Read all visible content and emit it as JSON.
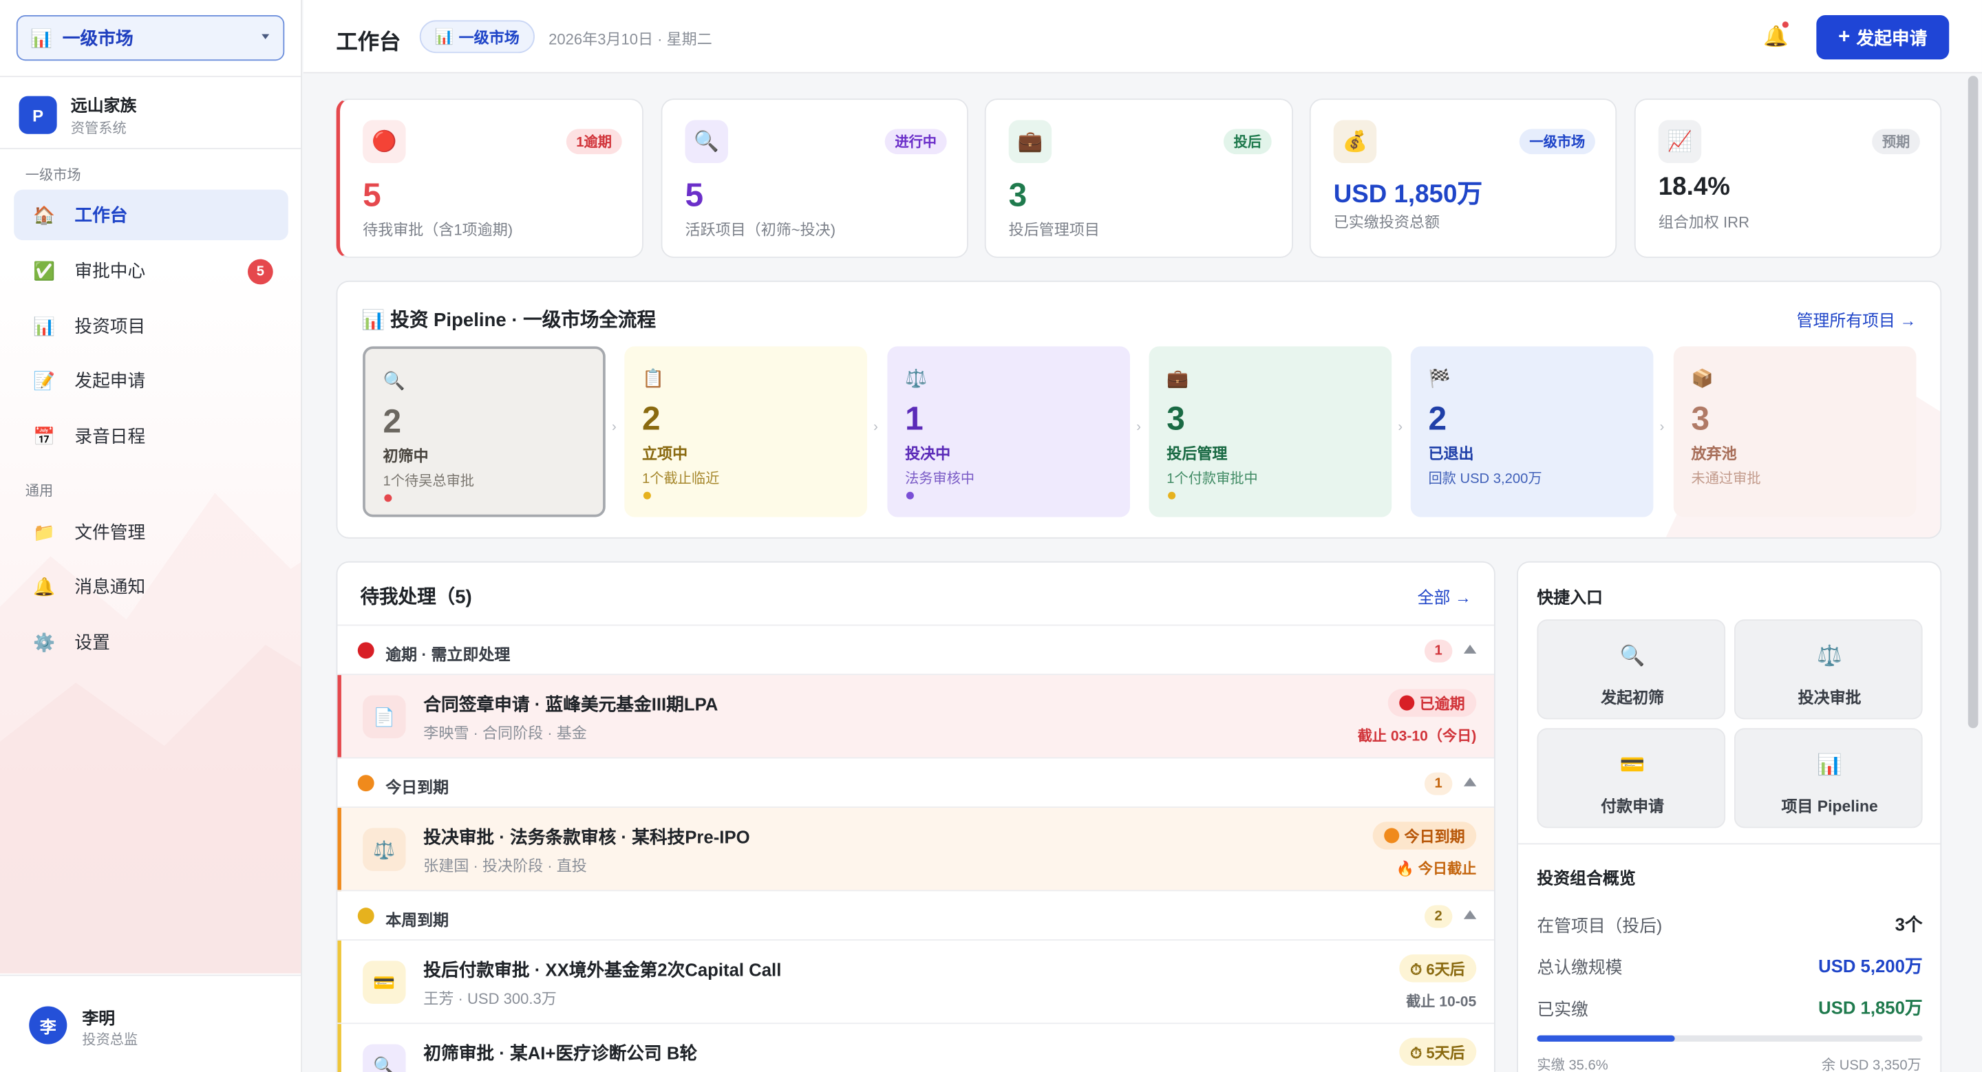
{
  "sidebar": {
    "market_select": "一级市场",
    "org_logo": "P",
    "org_name": "远山家族",
    "org_sub": "资管系统",
    "section1": "一级市场",
    "items1": [
      {
        "label": "工作台",
        "icon": "home-icon",
        "glyph": "🏠",
        "active": true
      },
      {
        "label": "审批中心",
        "icon": "check-icon",
        "glyph": "✅",
        "badge": "5"
      },
      {
        "label": "投资项目",
        "icon": "chart-icon",
        "glyph": "📊"
      },
      {
        "label": "发起申请",
        "icon": "memo-icon",
        "glyph": "📝"
      },
      {
        "label": "录音日程",
        "icon": "calendar-icon",
        "glyph": "📅"
      }
    ],
    "section2": "通用",
    "items2": [
      {
        "label": "文件管理",
        "icon": "folder-icon",
        "glyph": "📁"
      },
      {
        "label": "消息通知",
        "icon": "bell-icon",
        "glyph": "🔔"
      },
      {
        "label": "设置",
        "icon": "gear-icon",
        "glyph": "⚙️"
      }
    ],
    "user_avatar": "李",
    "user_name": "李明",
    "user_role": "投资总监"
  },
  "header": {
    "title": "工作台",
    "market_pill": "一级市场",
    "date": "2026年3月10日 · 星期二",
    "new_button": "发起申请"
  },
  "stats": [
    {
      "icon": "red-circle-icon",
      "glyph": "🔴",
      "tag": "1逾期",
      "value": "5",
      "label": "待我审批（含1项逾期)",
      "color": "#e5484d",
      "icon_bg": "#fdecec",
      "tag_bg": "#fde1e2",
      "tag_color": "#d1343a"
    },
    {
      "icon": "magnifier-icon",
      "glyph": "🔍",
      "tag": "进行中",
      "value": "5",
      "label": "活跃项目（初筛~投决)",
      "color": "#6b2fc9",
      "icon_bg": "#efeafd",
      "tag_bg": "#efe7fd",
      "tag_color": "#6b2fc9"
    },
    {
      "icon": "briefcase-icon",
      "glyph": "💼",
      "tag": "投后",
      "value": "3",
      "label": "投后管理项目",
      "color": "#1f7a4d",
      "icon_bg": "#e8f5ee",
      "tag_bg": "#e2f4ea",
      "tag_color": "#1f7a4d"
    },
    {
      "icon": "moneybag-icon",
      "glyph": "💰",
      "tag": "一级市场",
      "value": "USD 1,850万",
      "label": "已实缴投资总额",
      "color": "#1f45c8",
      "icon_bg": "#f7f0e3",
      "tag_bg": "#e6edfc",
      "tag_color": "#1f45c8"
    },
    {
      "icon": "trend-icon",
      "glyph": "📈",
      "tag": "预期",
      "value": "18.4%",
      "label": "组合加权 IRR",
      "color": "#1f2328",
      "icon_bg": "#f0f1f3",
      "tag_bg": "#eeeff2",
      "tag_color": "#8a8f98"
    }
  ],
  "pipeline": {
    "title": "投资 Pipeline · 一级市场全流程",
    "link": "管理所有项目 →",
    "stages": [
      {
        "icon": "magnifier-icon",
        "glyph": "🔍",
        "count": "2",
        "name": "初筛中",
        "sub": "1个待吴总审批",
        "bg": "#f1efec",
        "num_color": "#6b6760",
        "name_color": "#4a4640",
        "sub_color": "#7a766f",
        "dot": "#e5484d"
      },
      {
        "icon": "clipboard-icon",
        "glyph": "📋",
        "count": "2",
        "name": "立项中",
        "sub": "1个截止临近",
        "bg": "#fefbe8",
        "num_color": "#8a6a10",
        "name_color": "#8a6a10",
        "sub_color": "#a5862a",
        "dot": "#e6b21e"
      },
      {
        "icon": "scales-icon",
        "glyph": "⚖️",
        "count": "1",
        "name": "投决中",
        "sub": "法务审核中",
        "bg": "#efeafd",
        "num_color": "#5b2bb8",
        "name_color": "#5b2bb8",
        "sub_color": "#7a5bc6",
        "dot": "#7a4fd6"
      },
      {
        "icon": "briefcase-icon",
        "glyph": "💼",
        "count": "3",
        "name": "投后管理",
        "sub": "1个付款审批中",
        "bg": "#e8f5ee",
        "num_color": "#1a6a44",
        "name_color": "#1a6a44",
        "sub_color": "#3f8a63",
        "dot": "#e6b21e"
      },
      {
        "icon": "checkered-flag-icon",
        "glyph": "🏁",
        "count": "2",
        "name": "已退出",
        "sub": "回款 USD 3,200万",
        "bg": "#e9effc",
        "num_color": "#1f3fa8",
        "name_color": "#1f3fa8",
        "sub_color": "#3f5fb8",
        "dot": ""
      },
      {
        "icon": "package-icon",
        "glyph": "📦",
        "count": "3",
        "name": "放弃池",
        "sub": "未通过审批",
        "bg": "#fbf1ef",
        "num_color": "#b07a66",
        "name_color": "#a86f5a",
        "sub_color": "#c29a8b",
        "dot": ""
      }
    ]
  },
  "pending": {
    "title": "待我处理（5)",
    "link": "全部 →",
    "groups": [
      {
        "label": "逾期 · 需立即处理",
        "count": "1",
        "dot": "#d81f26",
        "cnt_bg": "#fde1e2",
        "cnt_color": "#d1343a"
      },
      {
        "label": "今日到期",
        "count": "1",
        "dot": "#f08a1c",
        "cnt_bg": "#fdeedd",
        "cnt_color": "#c4650e"
      },
      {
        "label": "本周到期",
        "count": "2",
        "dot": "#e6b21e",
        "cnt_bg": "#fdf4d5",
        "cnt_color": "#8a6a10"
      }
    ],
    "rows": [
      {
        "icon": "document-icon",
        "glyph": "📄",
        "title": "合同签章申请 · 蓝峰美元基金III期LPA",
        "sub": "李映雪 · 合同阶段 · 基金",
        "tag": "已逾期",
        "due": "截止 03-10（今日)",
        "bar": "#e5484d",
        "bg": "#fdf0f0",
        "icon_bg": "#fbe3e3",
        "tag_bg": "#fde1e2",
        "tag_color": "#d1343a",
        "tag_dot": "#d81f26",
        "due_color": "#d1343a"
      },
      {
        "icon": "scales-icon",
        "glyph": "⚖️",
        "title": "投决审批 · 法务条款审核 · 某科技Pre-IPO",
        "sub": "张建国 · 投决阶段 · 直投",
        "tag": "今日到期",
        "due": "🔥 今日截止",
        "bar": "#f08a1c",
        "bg": "#fef5ec",
        "icon_bg": "#fce9d6",
        "tag_bg": "#fde6cc",
        "tag_color": "#b8580a",
        "tag_dot": "#f08a1c",
        "due_color": "#c4650e"
      },
      {
        "icon": "credit-card-icon",
        "glyph": "💳",
        "title": "投后付款审批 · XX境外基金第2次Capital Call",
        "sub": "王芳 · USD 300.3万",
        "tag": "⏱ 6天后",
        "due": "截止 10-05",
        "bar": "#efc63a",
        "bg": "#ffffff",
        "icon_bg": "#fdf4d5",
        "tag_bg": "#fdf4d5",
        "tag_color": "#8a6a10",
        "tag_dot": "",
        "due_color": "#6a6f78"
      },
      {
        "icon": "magnifier-icon",
        "glyph": "🔍",
        "title": "初筛审批 · 某AI+医疗诊断公司 B轮",
        "sub": "",
        "tag": "⏱ 5天后",
        "due": "",
        "bar": "#efc63a",
        "bg": "#ffffff",
        "icon_bg": "#efeafd",
        "tag_bg": "#fdf4d5",
        "tag_color": "#8a6a10",
        "tag_dot": "",
        "due_color": "#6a6f78"
      }
    ]
  },
  "quick": {
    "title": "快捷入口",
    "buttons": [
      {
        "icon": "magnifier-icon",
        "glyph": "🔍",
        "label": "发起初筛"
      },
      {
        "icon": "scales-icon",
        "glyph": "⚖️",
        "label": "投决审批"
      },
      {
        "icon": "credit-card-icon",
        "glyph": "💳",
        "label": "付款申请"
      },
      {
        "icon": "chart-icon",
        "glyph": "📊",
        "label": "项目 Pipeline"
      }
    ],
    "portfolio_title": "投资组合概览",
    "kv": [
      {
        "k": "在管项目（投后)",
        "v": "3个",
        "color": "#1f2328"
      },
      {
        "k": "总认缴规模",
        "v": "USD 5,200万",
        "color": "#1f45c8"
      },
      {
        "k": "已实缴",
        "v": "USD 1,850万",
        "color": "#1f7a4d"
      }
    ],
    "progress_pct": 35.6,
    "progress_left": "实缴 35.6%",
    "progress_right": "余 USD 3,350万"
  }
}
